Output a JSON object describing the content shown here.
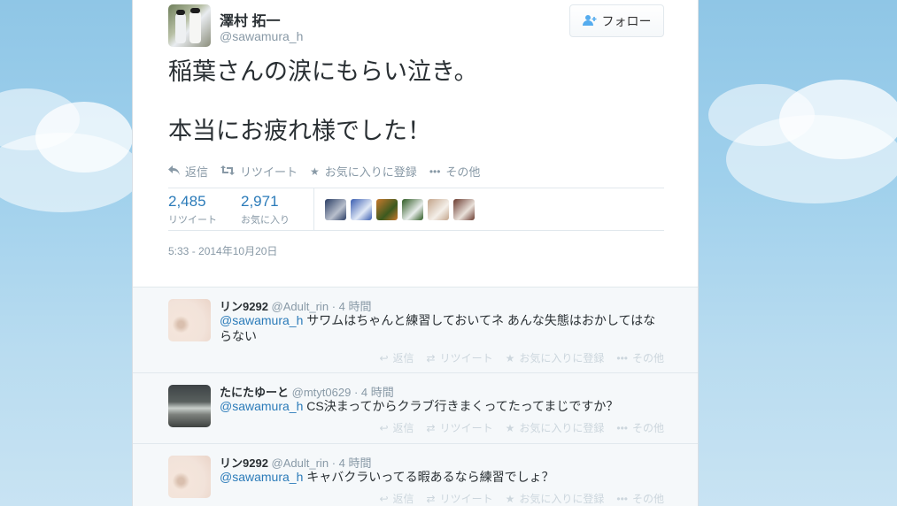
{
  "tweet": {
    "author_name": "澤村 拓一",
    "author_handle": "@sawamura_h",
    "follow_label": "フォロー",
    "text_line1": "稲葉さんの涙にもらい泣き。",
    "text_line2": "本当にお疲れ様でした！",
    "actions": {
      "reply": "返信",
      "retweet": "リツイート",
      "favorite": "お気に入りに登録",
      "more": "その他"
    },
    "retweet_count": "2,485",
    "retweet_label": "リツイート",
    "favorite_count": "2,971",
    "favorite_label": "お気に入り",
    "timestamp": "5:33 - 2014年10月20日"
  },
  "icons": {
    "reply": "reply-icon",
    "retweet": "retweet-icon",
    "favorite": "star-icon",
    "more": "more-dots-icon",
    "follow": "follow-user-icon"
  },
  "favoriters": [
    {
      "color1": "#2a3d64",
      "color2": "#b8bfcc"
    },
    {
      "color1": "#3a5db0",
      "color2": "#e0e8f6"
    },
    {
      "color1": "#c8782c",
      "color2": "#3c5a1f"
    },
    {
      "color1": "#2e5a22",
      "color2": "#e7ecea"
    },
    {
      "color1": "#c3a48a",
      "color2": "#f4efe9"
    },
    {
      "color1": "#6a3a2e",
      "color2": "#e9e1da"
    }
  ],
  "replies": [
    {
      "name": "リン9292",
      "handle": "@Adult_rin",
      "time": "· 4 時間",
      "mention": "@sawamura_h",
      "text": " サワムはちゃんと練習しておいてネ あんな失態はおかしてはならない"
    },
    {
      "name": "たにたゆーと",
      "handle": "@mtyt0629",
      "time": "· 4 時間",
      "mention": "@sawamura_h",
      "text": "  CS決まってからクラブ行きまくってたってまじですか？"
    },
    {
      "name": "リン9292",
      "handle": "@Adult_rin",
      "time": "· 4 時間",
      "mention": "@sawamura_h",
      "text": " キャバクラいってる暇あるなら練習でしょ？"
    }
  ],
  "colors": {
    "link": "#2b7bb9",
    "muted": "#8899a6",
    "text": "#292f33",
    "sky": "#9fd0ec"
  }
}
